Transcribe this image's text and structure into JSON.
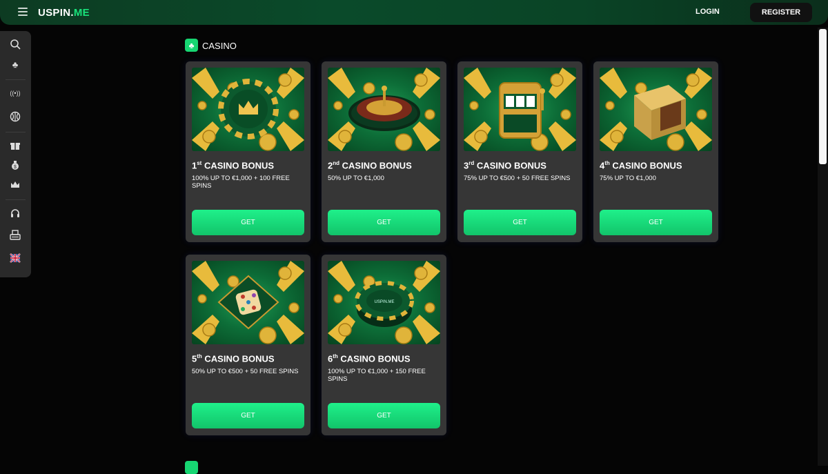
{
  "header": {
    "logo_part1": "USPIN.",
    "logo_part2": "ME",
    "login_label": "LOGIN",
    "register_label": "REGISTER"
  },
  "sidebar": {
    "icons": [
      "search-icon",
      "club-icon",
      "live-icon",
      "basketball-icon",
      "gift-icon",
      "money-bag-icon",
      "crown-icon",
      "headset-icon",
      "cashier-icon",
      "uk-flag-icon"
    ]
  },
  "section": {
    "title": "CASINO"
  },
  "cards": [
    {
      "ordinal": "1",
      "suffix": "st",
      "title": "CASINO BONUS",
      "desc": "100% UP TO €1,000 + 100 FREE SPINS",
      "cta": "GET",
      "art": "chip-crown"
    },
    {
      "ordinal": "2",
      "suffix": "nd",
      "title": "CASINO BONUS",
      "desc": "50% UP TO €1,000",
      "cta": "GET",
      "art": "roulette"
    },
    {
      "ordinal": "3",
      "suffix": "rd",
      "title": "CASINO BONUS",
      "desc": "75% UP TO €500 + 50 FREE SPINS",
      "cta": "GET",
      "art": "slot-machine"
    },
    {
      "ordinal": "4",
      "suffix": "th",
      "title": "CASINO BONUS",
      "desc": "75% UP TO €1,000",
      "cta": "GET",
      "art": "safe"
    },
    {
      "ordinal": "5",
      "suffix": "th",
      "title": "CASINO BONUS",
      "desc": "50% UP TO €500 + 50 FREE SPINS",
      "cta": "GET",
      "art": "dice"
    },
    {
      "ordinal": "6",
      "suffix": "th",
      "title": "CASINO BONUS",
      "desc": "100% UP TO €1,000 + 150 FREE SPINS",
      "cta": "GET",
      "art": "chip-logo",
      "chip_text": "USPIN.ME"
    }
  ],
  "colors": {
    "accent": "#19e37b",
    "card_bg": "#363636",
    "page_bg": "#050505"
  }
}
